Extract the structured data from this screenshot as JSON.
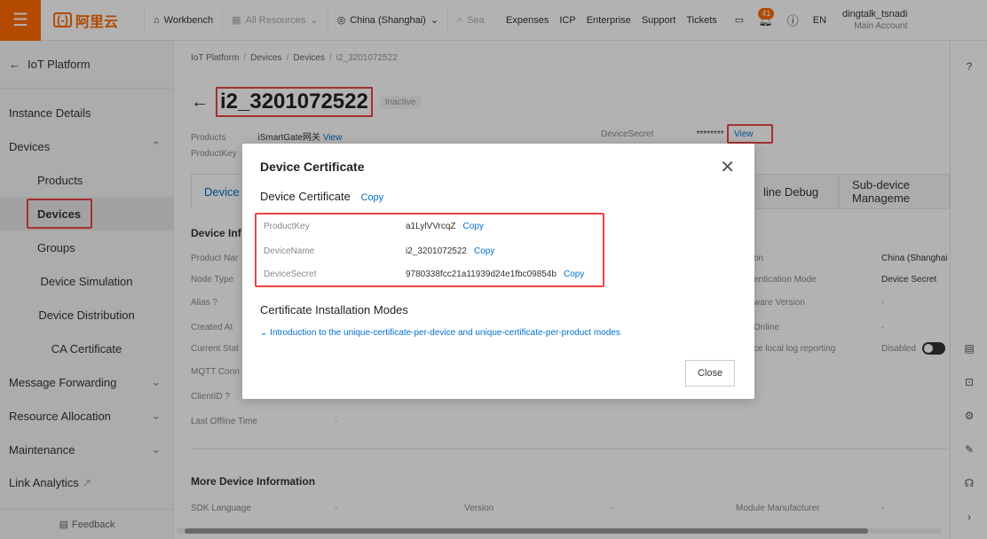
{
  "topbar": {
    "workbench": "Workbench",
    "all_resources": "All Resources",
    "region": "China (Shanghai)",
    "search_placeholder": "Sea",
    "links": [
      "Expenses",
      "ICP",
      "Enterprise",
      "Support",
      "Tickets"
    ],
    "notif_count": "41",
    "lang": "EN",
    "account": "dingtalk_tsnadi",
    "account_sub": "Main Account",
    "logo": "阿里云"
  },
  "sidebar": {
    "back": "IoT Platform",
    "items": {
      "instance": "Instance Details",
      "devices": "Devices",
      "products": "Products",
      "devices_sub": "Devices",
      "groups": "Groups",
      "simulation": "Device Simulation",
      "distribution": "Device Distribution",
      "ca": "CA Certificate",
      "msg": "Message Forwarding",
      "resource": "Resource Allocation",
      "maintenance": "Maintenance",
      "link": "Link Analytics"
    },
    "feedback": "Feedback"
  },
  "main": {
    "crumbs": [
      "IoT Platform",
      "Devices",
      "Devices",
      "i2_3201072522"
    ],
    "device_name": "i2_3201072522",
    "status": "Inactive",
    "products_label": "Products",
    "products_value": "iSmartGate网关",
    "view": "View",
    "productkey_label": "ProductKey",
    "secret_label": "DeviceSecret",
    "secret_mask": "********",
    "tabs": [
      "Device",
      "line Debug",
      "Sub-device Manageme"
    ],
    "device_info": "Device Inf",
    "labels": [
      "Product Nar",
      "Node Type",
      "Alias",
      "Created At",
      "Current Stat",
      "MQTT Conn",
      "ClientID",
      "Last Offline Time"
    ],
    "right_labels": [
      "on",
      "entication Mode",
      "ware Version",
      "Online",
      "ce local log reporting"
    ],
    "right_values": [
      "China (Shanghai",
      "Device Secret",
      "-",
      "-",
      "Disabled"
    ],
    "more": "More Device Information",
    "sdk": "SDK Language",
    "version": "Version",
    "module": "Module Manufacturer",
    "dash": "-"
  },
  "modal": {
    "title": "Device Certificate",
    "subtitle": "Device Certificate",
    "copy": "Copy",
    "rows": [
      {
        "k": "ProductKey",
        "v": "a1LylVVrcqZ"
      },
      {
        "k": "DeviceName",
        "v": "i2_3201072522"
      },
      {
        "k": "DeviceSecret",
        "v": "9780338fcc21a11939d24e1fbc09854b"
      }
    ],
    "modes_title": "Certificate Installation Modes",
    "intro": "Introduction to the unique-certificate-per-device and unique-certificate-per-product modes",
    "close": "Close"
  }
}
